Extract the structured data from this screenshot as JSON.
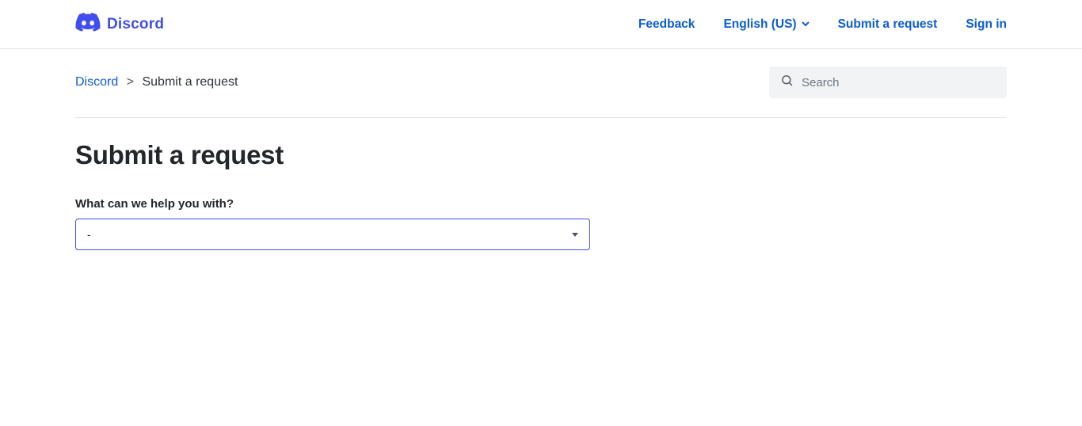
{
  "header": {
    "brand_name": "Discord",
    "nav": {
      "feedback": "Feedback",
      "language": "English (US)",
      "submit_request": "Submit a request",
      "sign_in": "Sign in"
    }
  },
  "breadcrumb": {
    "root": "Discord",
    "separator": ">",
    "current": "Submit a request"
  },
  "search": {
    "placeholder": "Search",
    "value": ""
  },
  "page": {
    "title": "Submit a request"
  },
  "form": {
    "question_label": "What can we help you with?",
    "select_value": "-"
  }
}
